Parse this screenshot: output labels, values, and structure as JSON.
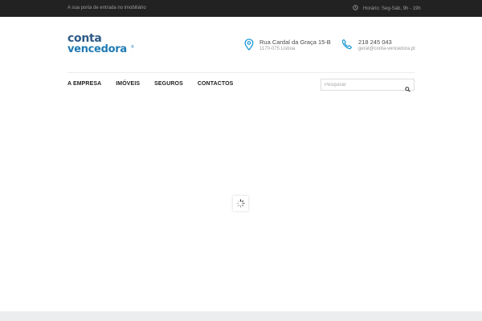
{
  "topbar": {
    "tagline": "A sua porta de entrada no imobiliário",
    "hours": "Horário: Seg-Sáb, 9h - 19h",
    "clock_icon": "clock-icon"
  },
  "brand": {
    "line1": "conta",
    "line2": "vencedora",
    "registered": "®",
    "colors": {
      "dark_blue": "#2d5a86",
      "light_blue": "#1f7bb3",
      "accent": "#1a9ad6"
    }
  },
  "contact": {
    "address_line1": "Rua Cardal da Graça 15-B",
    "address_line2": "1170-075 Lisboa",
    "address_icon": "map-pin-icon",
    "phone": "218 245 043",
    "email": "geral@conta-vencedora.pt",
    "phone_icon": "phone-icon"
  },
  "nav": {
    "items": [
      {
        "label": "A EMPRESA"
      },
      {
        "label": "IMÓVEIS"
      },
      {
        "label": "SEGUROS"
      },
      {
        "label": "CONTACTOS"
      }
    ]
  },
  "search": {
    "placeholder": "Pesquisar",
    "icon": "search-icon"
  },
  "loader": {
    "icon": "spinner-icon"
  }
}
